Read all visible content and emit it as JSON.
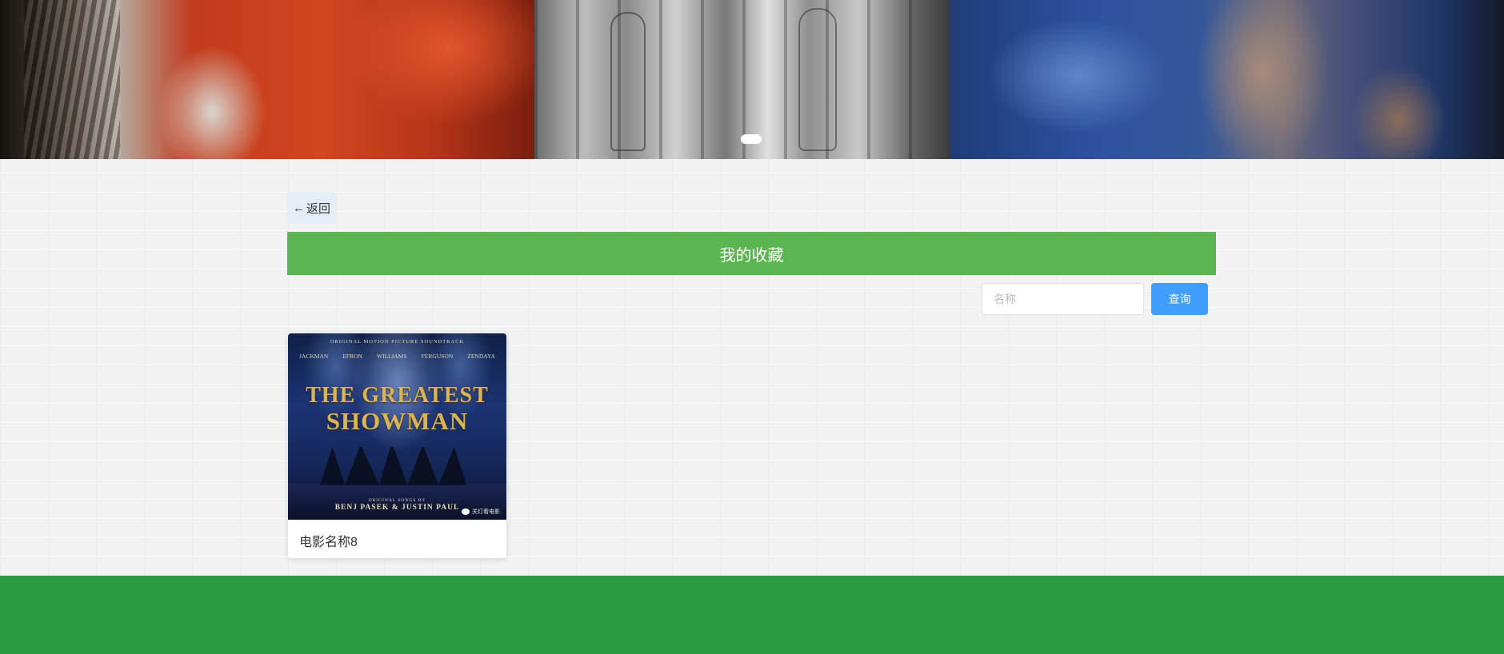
{
  "banner": {
    "active_slide": 2
  },
  "back_button": {
    "arrow": "←",
    "label": "返回"
  },
  "title": "我的收藏",
  "search": {
    "placeholder": "名称",
    "value": "",
    "button_label": "查询"
  },
  "movies": [
    {
      "name": "电影名称8",
      "poster": {
        "top_line": "ORIGINAL MOTION PICTURE SOUNDTRACK",
        "cast": [
          "JACKMAN",
          "EFRON",
          "WILLIAMS",
          "FERGUSON",
          "ZENDAYA"
        ],
        "title_line1": "THE GREATEST",
        "title_line2": "SHOWMAN",
        "songs_by": "ORIGINAL SONGS BY",
        "composers": "BENJ PASEK & JUSTIN PAUL",
        "badge": "关灯看电影"
      }
    }
  ],
  "colors": {
    "title_bar": "#5cb553",
    "search_button": "#409eff",
    "footer": "#289a3f",
    "back_button_bg": "#e4edf6"
  }
}
